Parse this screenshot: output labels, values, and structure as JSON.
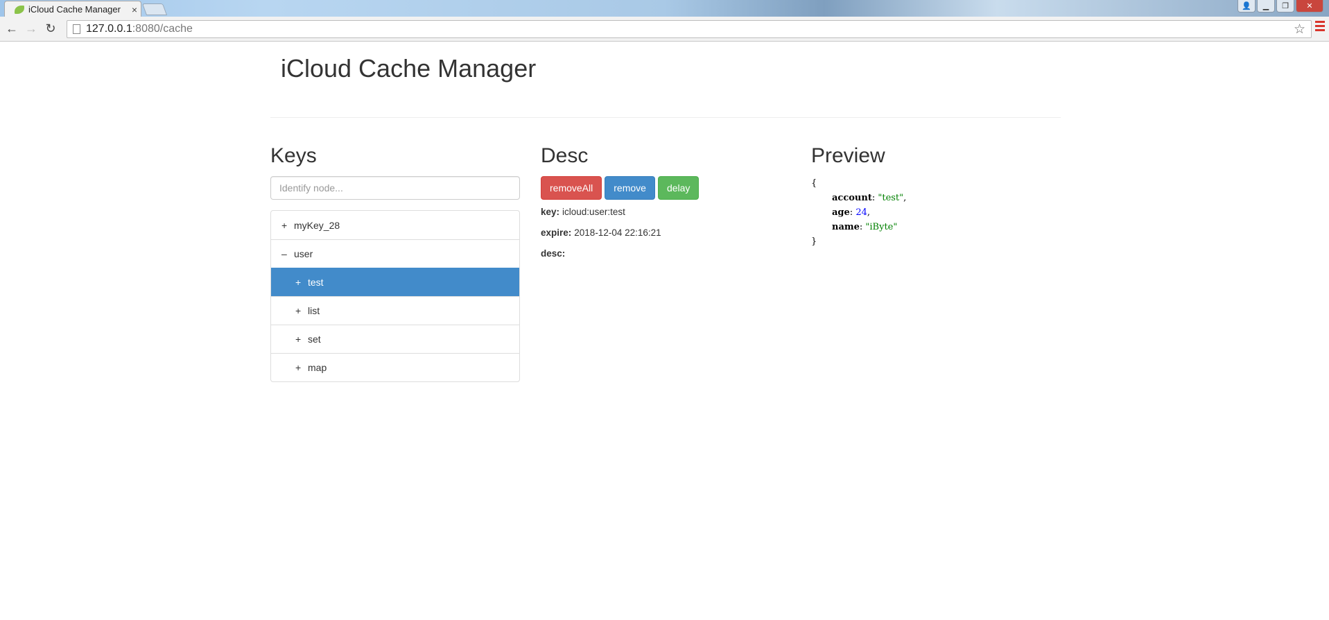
{
  "browser": {
    "tab_title": "iCloud Cache Manager",
    "tab_close": "×",
    "url_host": "127.0.0.1",
    "url_path": ":8080/cache"
  },
  "page": {
    "title": "iCloud Cache Manager"
  },
  "keys": {
    "heading": "Keys",
    "search_placeholder": "Identify node...",
    "nodes": [
      {
        "toggle": "+",
        "label": "myKey_28",
        "level": 0,
        "selected": false
      },
      {
        "toggle": "–",
        "label": "user",
        "level": 0,
        "selected": false
      },
      {
        "toggle": "+",
        "label": "test",
        "level": 1,
        "selected": true
      },
      {
        "toggle": "+",
        "label": "list",
        "level": 1,
        "selected": false
      },
      {
        "toggle": "+",
        "label": "set",
        "level": 1,
        "selected": false
      },
      {
        "toggle": "+",
        "label": "map",
        "level": 1,
        "selected": false
      }
    ]
  },
  "desc": {
    "heading": "Desc",
    "buttons": {
      "remove_all": "removeAll",
      "remove": "remove",
      "delay": "delay"
    },
    "key_label": "key:",
    "key_value": "icloud:user:test",
    "expire_label": "expire:",
    "expire_value": "2018-12-04 22:16:21",
    "desc_label": "desc:",
    "desc_value": ""
  },
  "preview": {
    "heading": "Preview",
    "open_brace": "{",
    "close_brace": "}",
    "fields": [
      {
        "key": "account",
        "value": "\"test\"",
        "kind": "str",
        "sep": ","
      },
      {
        "key": "age",
        "value": "24",
        "kind": "num",
        "sep": ","
      },
      {
        "key": "name",
        "value": "\"iByte\"",
        "kind": "str",
        "sep": ""
      }
    ]
  },
  "colors": {
    "primary": "#428bca",
    "danger": "#d9534f",
    "success": "#5cb85c"
  }
}
